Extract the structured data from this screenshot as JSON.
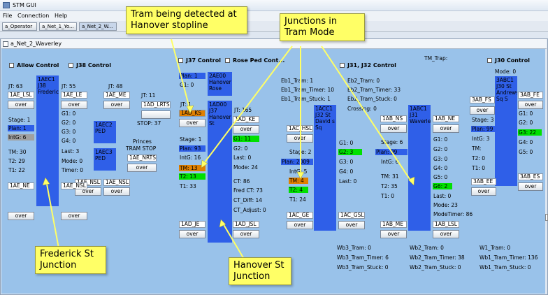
{
  "window": {
    "title": "STM GUI"
  },
  "menu": [
    "File",
    "Connection",
    "Help"
  ],
  "tabs": [
    "a_Operator",
    "a_Net_1_Yo...",
    "a_Net_2_W..."
  ],
  "frame_title": "a_Net_2_Waverley",
  "controls": {
    "allow_control": "Allow Control",
    "j38": "J38 Control",
    "j37": "J37 Control",
    "rose_ped": "Rose Ped Cont...",
    "j31_j32": "J31, J32 Control",
    "j30": "J30 Control",
    "tm_trap": "TM_Trap:"
  },
  "j38": {
    "jt": "JT: 63",
    "detector_le": "1AE_LSL",
    "detector_le2": "1AE_LE",
    "over": "over",
    "jt2": "JT: 55",
    "jt3": "JT: 48",
    "me": "1AE_ME",
    "block": "1AEC1 J38 Frederick",
    "stage": "Stage: 1",
    "plan": "Plan: 1",
    "intg": "IntG: 6",
    "tm": "TM: 30",
    "t2": "T2: 29",
    "t1": "T1: 22",
    "g1": "G1: 0",
    "g2": "G2: 0",
    "g3": "G3: 0",
    "g4": "G4: 0",
    "last": "Last: 3",
    "mode": "Mode: 0",
    "timer": "Timer: 0",
    "ped2": "1AEC2 PED",
    "ped3": "1AEC3 PED",
    "nsl1": "1AE_NSL",
    "nsl2": "1AE_NSL",
    "ne": "1AE_NE",
    "nsl3": "1AE_NSL",
    "princes": "Princes",
    "tram_stop": "TRAM STOP",
    "nrts": "1AE_NRTS"
  },
  "j37": {
    "jt": "JT: 11",
    "lrts": "1AD_LRTS",
    "stop": "STOP: 37",
    "jt1": "JT: 1",
    "plan_top": "Plan: 1",
    "g1_top": "G1: 0",
    "rose": "2AE00 Hanover Rose",
    "ks": "1AD_KS",
    "block": "1AD00 J37 Hanover St",
    "jt2": "JT: 165",
    "ke": "1AD_KE",
    "stage": "Stage: 1",
    "plan": "Plan: 93",
    "intg": "IntG: 16",
    "tm": "TM: 13",
    "t2": "T2: 13",
    "t1": "T1: 33",
    "g1": "G1: 11",
    "g2": "G2: 0",
    "last": "Last: 0",
    "mode": "Mode: 24",
    "ct": "CT: 86",
    "fred_ct": "Fred CT: 73",
    "ct_diff": "CT_Diff: 14",
    "ct_adj": "CT_Adjust: 0",
    "je": "1AD_JE",
    "jsl": "1AD_JSL"
  },
  "j32": {
    "eb1_tram": "Eb1_Tram: 1",
    "eb1_timer": "Eb1_Tram_Timer: 10",
    "eb1_stuck": "Eb1_Tram_Stuck: 1",
    "eb2_tram": "Eb2_Tram: 0",
    "eb2_timer": "Eb2_Tram_Timer: 33",
    "eb2_stuck": "Eb2_Tram_Stuck: 0",
    "crossing": "Crossing: 0",
    "hsl": "1AC_HSL",
    "block": "1ACC1 J32 St David s Sq",
    "stage": "Stage: 2",
    "plan": "Plan: 2009",
    "intg": "IntG: 5",
    "tm": "TM: 4",
    "t2": "T2: 4",
    "t1": "T1: 24",
    "g1": "G1: 0",
    "g2": "G2: 3",
    "g3": "G3: 0",
    "g4": "G4: 0",
    "last": "Last: 0",
    "ge": "1AC_GE",
    "gsl": "1AC_GSL",
    "wb3_tram": "Wb3_Tram: 0",
    "wb3_timer": "Wb3_Tram_Timer: 6",
    "wb3_stuck": "Wb3_Tram_Stuck: 0"
  },
  "j31": {
    "ns": "1AB_NS",
    "ne": "1AB_NE",
    "block": "1ABC1 J31 Waverley",
    "stage": "Stage: 6",
    "plan": "Plan: 99",
    "intg": "IntG: 6",
    "tm": "TM: 31",
    "t2": "T2: 35",
    "t1": "T1: 0",
    "g1": "G1: 0",
    "g2": "G2: 0",
    "g3": "G3: 0",
    "g4": "G4: 0",
    "g5": "G5: 0",
    "g6": "G6: 2",
    "last": "Last: 0",
    "mode": "Mode: 23",
    "mode_timer": "ModeTimer: 86",
    "me": "1AB_ME",
    "lsl": "1AB_LSL",
    "wb2_tram": "Wb2_Tram: 0",
    "wb2_timer": "Wb2_Tram_Timer: 38",
    "wb2_stuck": "Wb2_Tram_Stuck: 0"
  },
  "j30": {
    "mode": "Mode: 0",
    "fs": "3AB_FS",
    "fe": "3AB_FE",
    "block": "3ABC1 J30 St Andrews Sq S",
    "stage": "Stage: 3",
    "plan": "Plan: 99",
    "intg": "IntG: 3",
    "tm": "TM:",
    "t2": "T2: 0",
    "t1": "T1: 0",
    "g1": "G1: 0",
    "g2": "G2: 0",
    "g3": "G3: 22",
    "g4": "G4: 0",
    "g5": "G5: 0",
    "ee": "3AB_EE",
    "es": "3AB_ES",
    "w1_tram": "W1_Tram: 0",
    "wb1_timer": "Wb1_Tram_Timer: 136",
    "wb1_stuck": "Wb1_Tram_Stuck: 0"
  },
  "callouts": {
    "tram_detected": "Tram being detected at Hanover stopline",
    "junctions_tram": "Junctions in Tram Mode",
    "frederick": "Frederick St Junction",
    "hanover": "Hanover St Junction"
  }
}
